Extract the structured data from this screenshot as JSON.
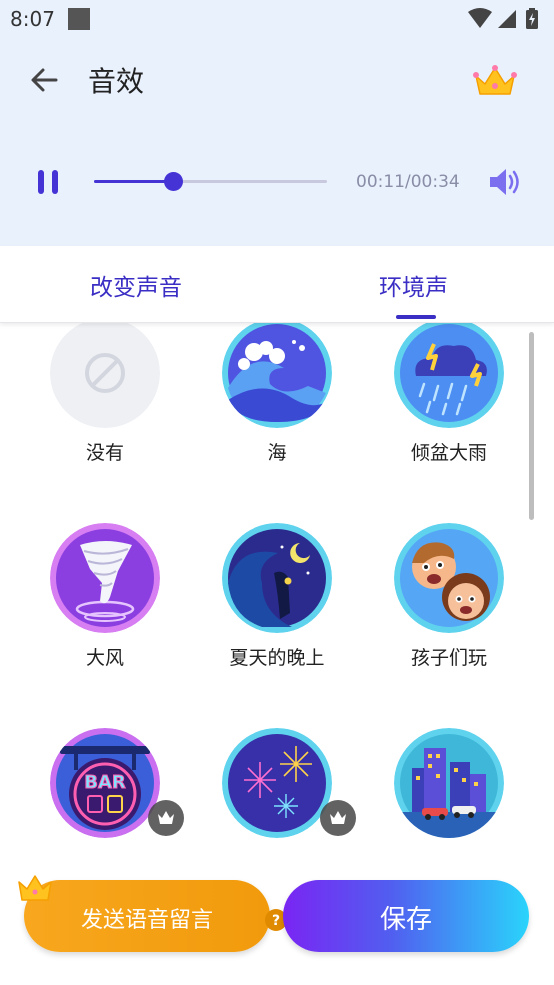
{
  "status_bar": {
    "time": "8:07"
  },
  "header": {
    "title": "音效"
  },
  "player": {
    "time_display": "00:11/00:34",
    "progress": 0.34
  },
  "tabs": [
    {
      "label": "改变声音",
      "selected": false
    },
    {
      "label": "环境声",
      "selected": true
    }
  ],
  "effects": [
    {
      "label": "没有",
      "icon": "none-icon",
      "premium": false
    },
    {
      "label": "海",
      "icon": "ocean-wave-icon",
      "premium": false
    },
    {
      "label": "倾盆大雨",
      "icon": "heavy-rain-icon",
      "premium": false
    },
    {
      "label": "大风",
      "icon": "tornado-icon",
      "premium": false
    },
    {
      "label": "夏天的晚上",
      "icon": "summer-night-icon",
      "premium": false
    },
    {
      "label": "孩子们玩",
      "icon": "kids-playing-icon",
      "premium": false
    },
    {
      "label": "",
      "icon": "bar-sign-icon",
      "premium": true
    },
    {
      "label": "",
      "icon": "fireworks-icon",
      "premium": true
    },
    {
      "label": "",
      "icon": "city-traffic-icon",
      "premium": false
    }
  ],
  "bottom": {
    "voicemail_label": "发送语音留言",
    "save_label": "保存"
  },
  "colors": {
    "accent": "#4533d6",
    "header_bg": "#e9f1fd",
    "voicemail": "#f5a117",
    "save_start": "#7a25f3",
    "save_end": "#2ad4fb"
  }
}
